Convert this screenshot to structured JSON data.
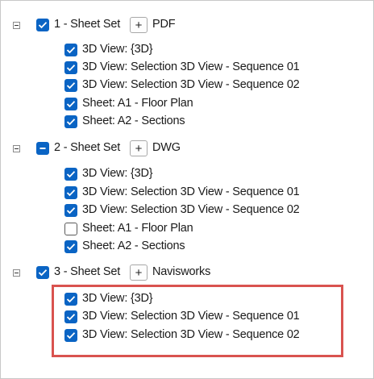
{
  "colors": {
    "checkbox_checked": "#0a64c4",
    "highlight_border": "#d9534f"
  },
  "tree": {
    "sets": [
      {
        "label": "1 - Sheet Set",
        "format": "PDF",
        "add_button": "+",
        "state": "checked",
        "expanded": true,
        "items": [
          {
            "label": "3D View: {3D}",
            "checked": true
          },
          {
            "label": "3D View: Selection 3D View - Sequence 01",
            "checked": true
          },
          {
            "label": "3D View: Selection 3D View - Sequence 02",
            "checked": true
          },
          {
            "label": "Sheet: A1 - Floor Plan",
            "checked": true
          },
          {
            "label": "Sheet: A2 - Sections",
            "checked": true
          }
        ]
      },
      {
        "label": "2 - Sheet Set",
        "format": "DWG",
        "add_button": "+",
        "state": "partial",
        "expanded": true,
        "items": [
          {
            "label": "3D View: {3D}",
            "checked": true
          },
          {
            "label": "3D View: Selection 3D View - Sequence 01",
            "checked": true
          },
          {
            "label": "3D View: Selection 3D View - Sequence 02",
            "checked": true
          },
          {
            "label": "Sheet: A1 - Floor Plan",
            "checked": false
          },
          {
            "label": "Sheet: A2 - Sections",
            "checked": true
          }
        ]
      },
      {
        "label": "3 - Sheet Set",
        "format": "Navisworks",
        "add_button": "+",
        "state": "checked",
        "expanded": true,
        "items": [
          {
            "label": "3D View: {3D}",
            "checked": true
          },
          {
            "label": "3D View: Selection 3D View - Sequence 01",
            "checked": true
          },
          {
            "label": "3D View: Selection 3D View - Sequence 02",
            "checked": true
          }
        ]
      }
    ]
  }
}
